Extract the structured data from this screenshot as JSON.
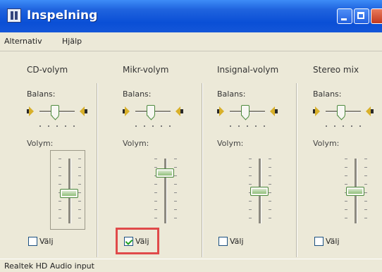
{
  "window": {
    "title": "Inspelning"
  },
  "menu": [
    {
      "label": "Alternativ"
    },
    {
      "label": "Hjälp"
    }
  ],
  "balance_label": "Balans:",
  "volume_label": "Volym:",
  "mute_label": "Välj",
  "channels": [
    {
      "title": "CD-volym",
      "balance": 0.5,
      "volume": 0.45,
      "selected": false
    },
    {
      "title": "Mikr-volym",
      "balance": 0.5,
      "volume": 0.82,
      "selected": true
    },
    {
      "title": "Insignal-volym",
      "balance": 0.5,
      "volume": 0.5,
      "selected": false
    },
    {
      "title": "Stereo mix",
      "balance": 0.5,
      "volume": 0.5,
      "selected": false
    }
  ],
  "status_bar": {
    "text": "Realtek HD Audio input"
  },
  "colors": {
    "titlebar": "#0a4fd6",
    "highlight": "#e04a4a",
    "thumb_accent": "#4d8a3e"
  }
}
